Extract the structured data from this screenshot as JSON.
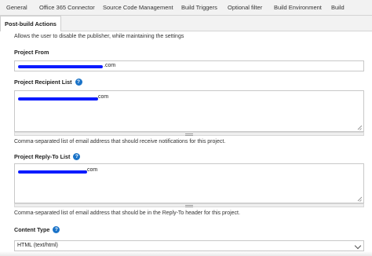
{
  "tabs": [
    "General",
    "Office 365 Connector",
    "Source Code Management",
    "Build Triggers",
    "Optional filter",
    "Build Environment",
    "Build"
  ],
  "active_tab": "Post-build Actions",
  "intro_text": "Allows the user to disable the publisher, while maintaining the settings",
  "project_from": {
    "label": "Project From",
    "value_suffix": ".com"
  },
  "recipient_list": {
    "label": "Project Recipient List",
    "value_suffix": ".com",
    "help": "Comma-separated list of email address that should receive notifications for this project."
  },
  "reply_to_list": {
    "label": "Project Reply-To List",
    "value_suffix": ".com",
    "help": "Comma-separated list of email address that should be in the Reply-To header for this project."
  },
  "content_type": {
    "label": "Content Type",
    "selected": "HTML (text/html)"
  },
  "help_icon": "?",
  "colors": {
    "accent": "#1a73c8",
    "redaction": "#0b1bff"
  }
}
